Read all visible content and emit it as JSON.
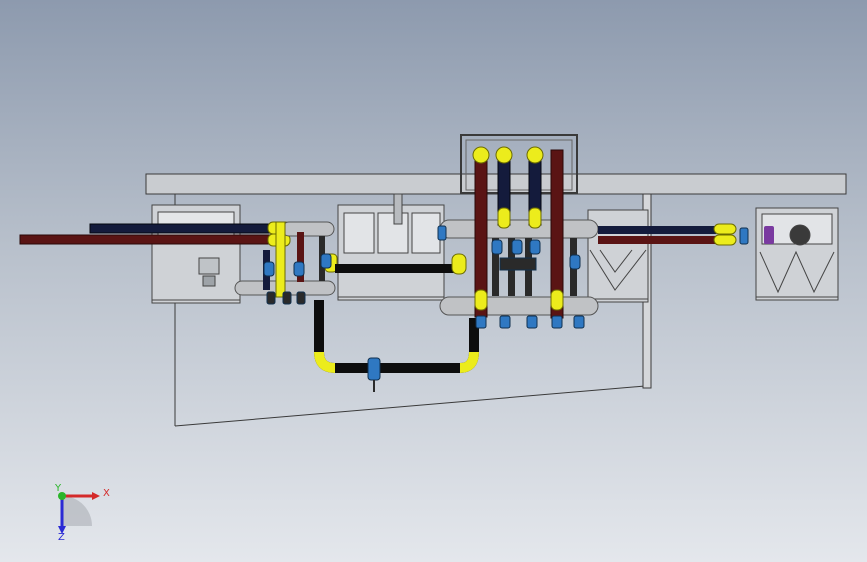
{
  "viewport": {
    "background_top": "#8d9aae",
    "background_bottom": "#e4e7ec"
  },
  "colors": {
    "frame_gray": "#c9ccd0",
    "frame_outline": "#3a3a3a",
    "pipe_yellow": "#ecec1c",
    "pipe_dark_red": "#5a1414",
    "pipe_navy": "#141b3c",
    "pipe_black": "#0d0d0d",
    "pipe_gray": "#c0c2c5",
    "valve_blue": "#2f78c2",
    "valve_dark": "#2a2a2a"
  },
  "triad": {
    "x_label": "X",
    "y_label": "Y",
    "z_label": "Z",
    "x_color": "#d42a2a",
    "y_color": "#2ab52a",
    "z_color": "#2a2ad4"
  }
}
